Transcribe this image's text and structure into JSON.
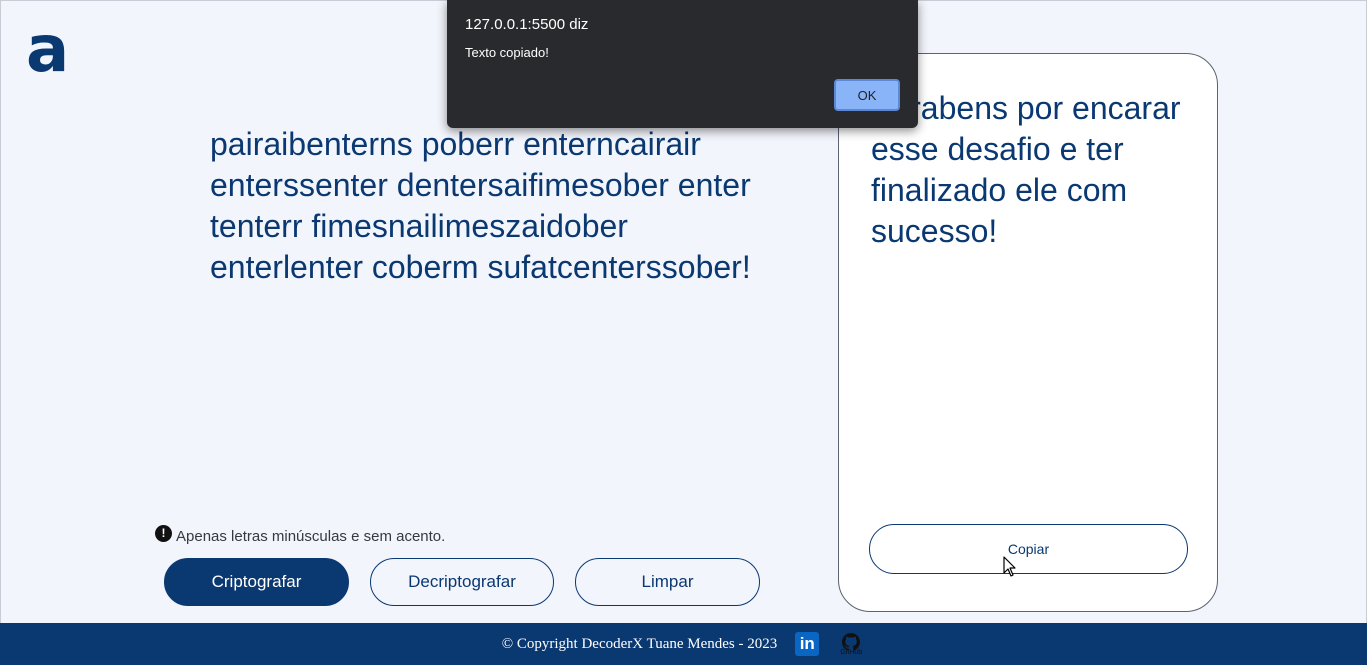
{
  "logo": {
    "glyph": "a"
  },
  "input": {
    "text": "pairaibenterns poberr enterncairair enterssenter dentersaifimesober enter tenterr fimesnailimeszaidober enterlenter coberm sufatcenterssober!"
  },
  "hint": {
    "icon": "!",
    "text": "Apenas letras minúsculas e sem acento."
  },
  "buttons": {
    "encrypt": "Criptografar",
    "decrypt": "Decriptografar",
    "clear": "Limpar"
  },
  "output": {
    "text": "Parabens por encarar esse desafio e ter finalizado ele com sucesso!",
    "copy_label": "Copiar"
  },
  "footer": {
    "text": "© Copyright DecoderX Tuane Mendes - 2023",
    "linkedin_glyph": "in",
    "github_label": "GitHub"
  },
  "dialog": {
    "title": "127.0.0.1:5500 diz",
    "message": "Texto copiado!",
    "ok_label": "OK"
  },
  "colors": {
    "primary": "#0a3871",
    "background": "#f3f5fc",
    "dialog_bg": "#292a2d",
    "dialog_button": "#8ab4f8"
  }
}
